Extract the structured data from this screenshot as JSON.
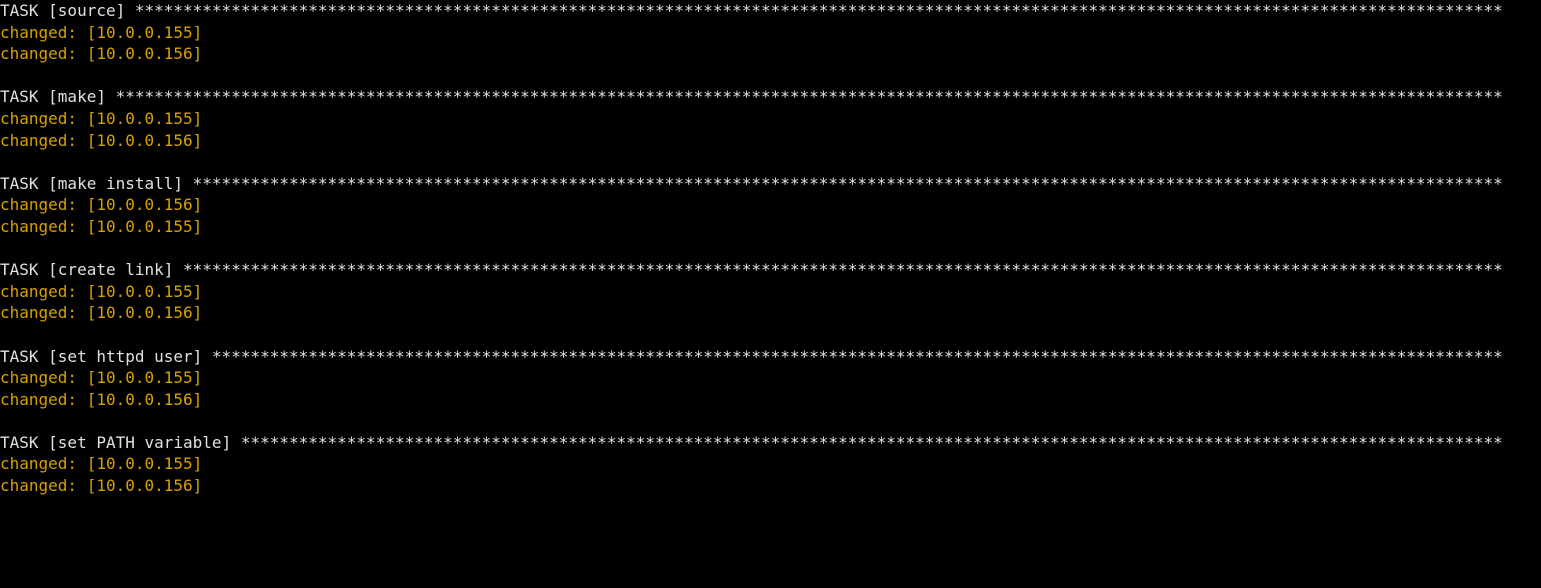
{
  "terminal": {
    "task_word": "TASK",
    "changed_word": "changed:",
    "tasks": [
      {
        "name": "source",
        "hosts": [
          "10.0.0.155",
          "10.0.0.156"
        ]
      },
      {
        "name": "make",
        "hosts": [
          "10.0.0.155",
          "10.0.0.156"
        ]
      },
      {
        "name": "make install",
        "hosts": [
          "10.0.0.156",
          "10.0.0.155"
        ]
      },
      {
        "name": "create link",
        "hosts": [
          "10.0.0.155",
          "10.0.0.156"
        ]
      },
      {
        "name": "set httpd user",
        "hosts": [
          "10.0.0.155",
          "10.0.0.156"
        ]
      },
      {
        "name": "set PATH variable",
        "hosts": [
          "10.0.0.155",
          "10.0.0.156"
        ]
      }
    ]
  },
  "colors": {
    "background": "#000000",
    "task_header": "#e0e0e0",
    "changed": "#d6a100"
  }
}
